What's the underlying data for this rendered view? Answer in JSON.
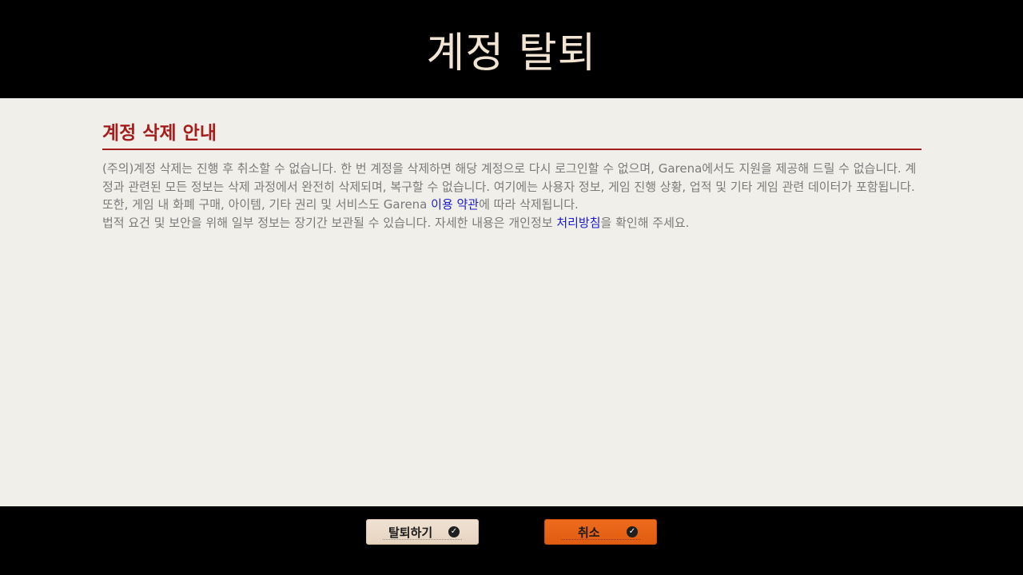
{
  "header": {
    "title": "계정 탈퇴"
  },
  "notice": {
    "heading": "계정 삭제 안내",
    "para1_text_a": "(주의)계정 삭제는 진행 후 취소할 수 없습니다. 한 번 계정을 삭제하면 해당 계정으로 다시 로그인할 수 없으며, Garena에서도 지원을 제공해 드릴 수 없습니다. 계정과 관련된 모든 정보는 삭제 과정에서 완전히 삭제되며, 복구할 수 없습니다. 여기에는 사용자 정보, 게임 진행 상황, 업적 및 기타 게임 관련 데이터가 포함됩니다. 또한, 게임 내 화폐 구매, 아이템, 기타 권리 및 서비스도 Garena ",
    "terms_link": "이용 약관",
    "para1_text_b": "에 따라 삭제됩니다.",
    "para2_text_a": "법적 요건 및 보안을 위해 일부 정보는 장기간 보관될 수 있습니다. 자세한 내용은 개인정보 ",
    "privacy_link": "처리방침",
    "para2_text_b": "을 확인해 주세요."
  },
  "footer": {
    "leave_label": "탈퇴하기",
    "cancel_label": "취소"
  },
  "colors": {
    "accent_red": "#a51d1d",
    "link_blue": "#1a1acb",
    "cancel_orange": "#e8641a",
    "leave_beige": "#ecdccb"
  },
  "icons": {
    "leave_button_icon": "check-circle-icon",
    "cancel_button_icon": "check-circle-icon"
  }
}
